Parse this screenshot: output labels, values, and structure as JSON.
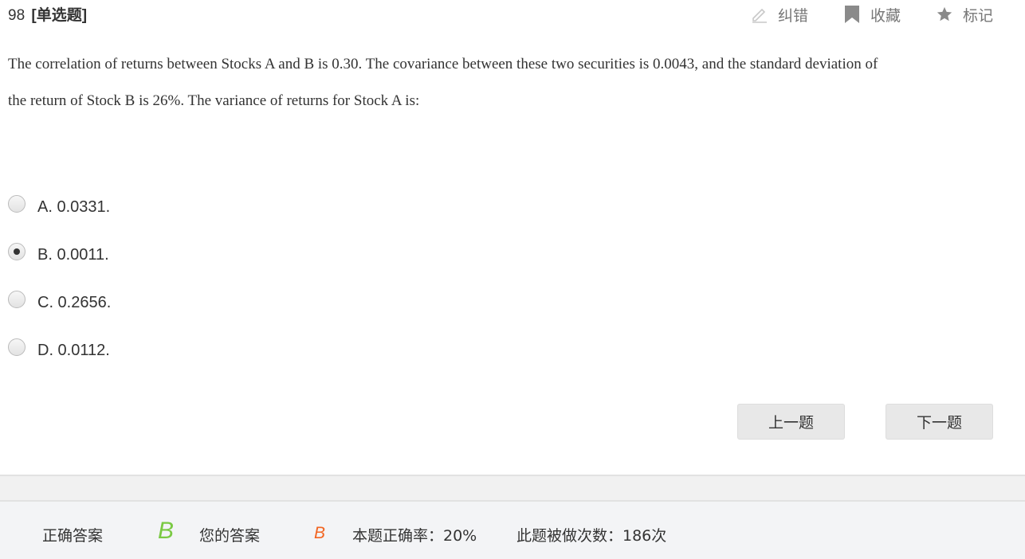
{
  "question": {
    "number": "98",
    "type_label": "[单选题]",
    "stem_lines": [
      "The correlation of returns between Stocks A and B is 0.30. The covariance between these two securities is 0.0043, and the standard deviation of",
      "the return of Stock B is 26%. The variance of returns for Stock A is:"
    ]
  },
  "tools": {
    "report": {
      "label": "纠错",
      "icon": "pencil-icon"
    },
    "favorite": {
      "label": "收藏",
      "icon": "bookmark-icon"
    },
    "mark": {
      "label": "标记",
      "icon": "star-icon"
    }
  },
  "options": [
    {
      "label": "A. 0.0331.",
      "selected": false
    },
    {
      "label": "B. 0.0011.",
      "selected": true
    },
    {
      "label": "C. 0.2656.",
      "selected": false
    },
    {
      "label": "D. 0.0112.",
      "selected": false
    }
  ],
  "navigation": {
    "prev_label": "上一题",
    "next_label": "下一题"
  },
  "result": {
    "correct_label": "正确答案",
    "correct_value": "B",
    "your_label": "您的答案",
    "your_value": "B",
    "accuracy_text": "本题正确率：20%",
    "attempts_text": "此题被做次数：186次"
  },
  "colors": {
    "correct": "#7ac943",
    "user_answer": "#f26522",
    "tool_text": "#777777"
  }
}
